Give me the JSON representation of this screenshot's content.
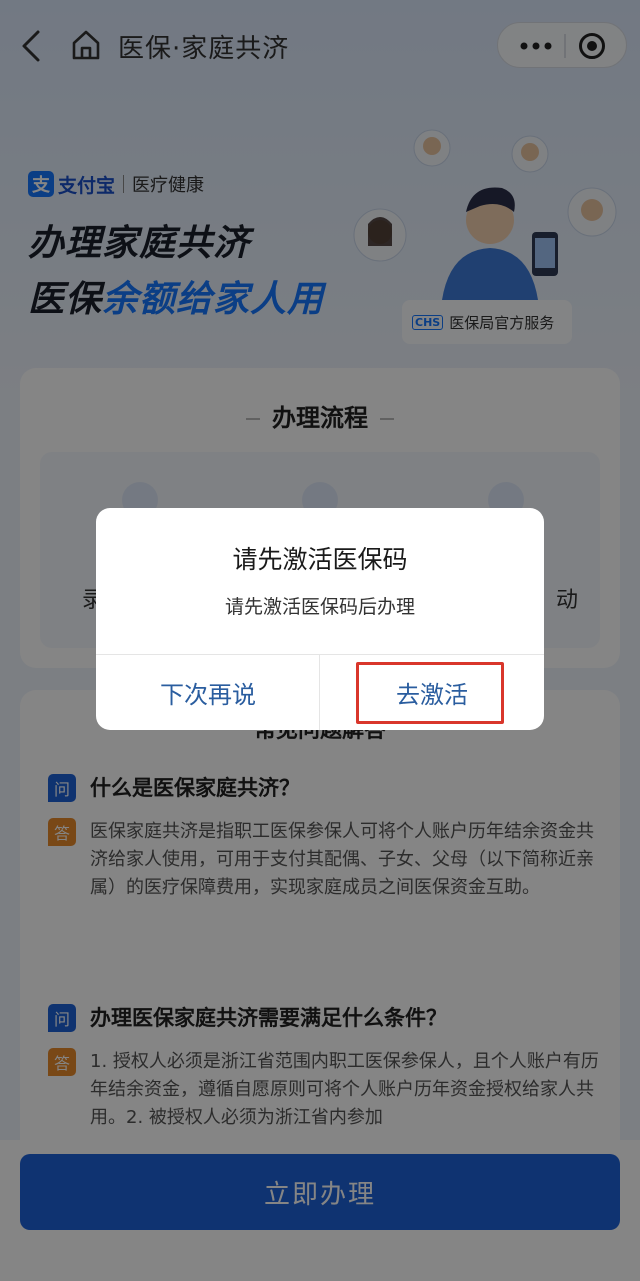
{
  "navbar": {
    "title": "医保·家庭共济"
  },
  "hero": {
    "brand_name": "支付宝",
    "brand_logo": "支",
    "brand_sub": "医疗健康",
    "line1": "办理家庭共济",
    "line2_prefix": "医保",
    "line2_highlight": "余额给家人用",
    "official_icon": "CHS",
    "official_text": "医保局官方服务"
  },
  "flow": {
    "title": "办理流程",
    "steps": [
      {
        "label": "录"
      },
      {
        "label": "动"
      }
    ]
  },
  "faq": {
    "header": "常见问题解答",
    "q_tag": "问",
    "a_tag": "答",
    "items": [
      {
        "question": "什么是医保家庭共济？",
        "answer": "医保家庭共济是指职工医保参保人可将个人账户历年结余资金共济给家人使用，可用于支付其配偶、子女、父母（以下简称近亲属）的医疗保障费用，实现家庭成员之间医保资金互助。"
      },
      {
        "question": "办理医保家庭共济需要满足什么条件？",
        "answer": "1. 授权人必须是浙江省范围内职工医保参保人，且个人账户有历年结余资金，遵循自愿原则可将个人账户历年资金授权给家人共用。2. 被授权人必须为浙江省内参加"
      }
    ]
  },
  "cta": {
    "label": "立即办理"
  },
  "dialog": {
    "title": "请先激活医保码",
    "message": "请先激活医保码后办理",
    "cancel_label": "下次再说",
    "confirm_label": "去激活"
  },
  "colors": {
    "primary": "#1e62d9",
    "accent_text": "#1677ff",
    "dialog_button_text": "#2a5d9f",
    "highlight_box": "#d9362b",
    "answer_tag": "#e98a2b"
  }
}
